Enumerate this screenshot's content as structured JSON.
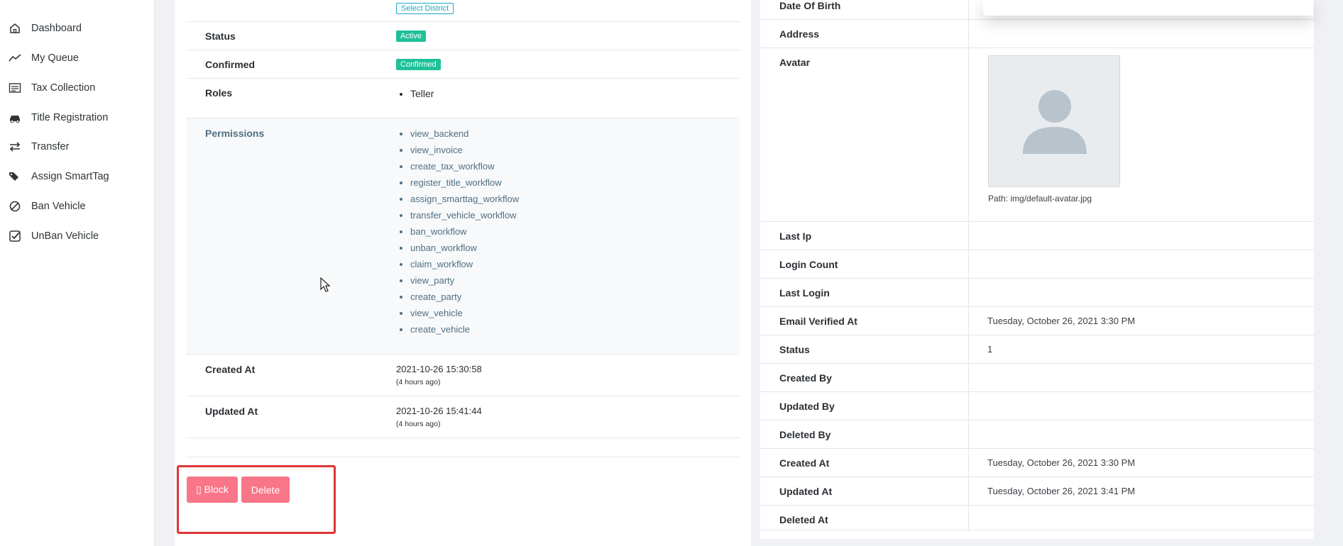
{
  "sidebar": {
    "items": [
      {
        "label": "Dashboard",
        "icon": "home-icon"
      },
      {
        "label": "My Queue",
        "icon": "trend-icon"
      },
      {
        "label": "Tax Collection",
        "icon": "list-icon"
      },
      {
        "label": "Title Registration",
        "icon": "car-icon"
      },
      {
        "label": "Transfer",
        "icon": "swap-icon"
      },
      {
        "label": "Assign SmartTag",
        "icon": "tags-icon"
      },
      {
        "label": "Ban Vehicle",
        "icon": "ban-icon"
      },
      {
        "label": "UnBan Vehicle",
        "icon": "check-square-icon"
      }
    ]
  },
  "user_detail": {
    "district_button": "Select District",
    "status_label": "Status",
    "status_value": "Active",
    "confirmed_label": "Confirmed",
    "confirmed_value": "Confirmed",
    "roles_label": "Roles",
    "roles": [
      "Teller"
    ],
    "permissions_label": "Permissions",
    "permissions": [
      "view_backend",
      "view_invoice",
      "create_tax_workflow",
      "register_title_workflow",
      "assign_smarttag_workflow",
      "transfer_vehicle_workflow",
      "ban_workflow",
      "unban_workflow",
      "claim_workflow",
      "view_party",
      "create_party",
      "view_vehicle",
      "create_vehicle"
    ],
    "created_at_label": "Created At",
    "created_at": "2021-10-26 15:30:58",
    "created_at_relative": "(4 hours ago)",
    "updated_at_label": "Updated At",
    "updated_at": "2021-10-26 15:41:44",
    "updated_at_relative": "(4 hours ago)"
  },
  "actions": {
    "block_label": "▯ Block",
    "delete_label": "Delete"
  },
  "profile": {
    "dob_label": "Date Of Birth",
    "address_label": "Address",
    "avatar_label": "Avatar",
    "avatar_path": "Path: img/default-avatar.jpg",
    "rows": [
      {
        "label": "Last Ip",
        "value": ""
      },
      {
        "label": "Login Count",
        "value": ""
      },
      {
        "label": "Last Login",
        "value": ""
      },
      {
        "label": "Email Verified At",
        "value": "Tuesday, October 26, 2021 3:30 PM"
      },
      {
        "label": "Status",
        "value": "1"
      },
      {
        "label": "Created By",
        "value": ""
      },
      {
        "label": "Updated By",
        "value": ""
      },
      {
        "label": "Deleted By",
        "value": ""
      },
      {
        "label": "Created At",
        "value": "Tuesday, October 26, 2021 3:30 PM"
      },
      {
        "label": "Updated At",
        "value": "Tuesday, October 26, 2021 3:41 PM"
      },
      {
        "label": "Deleted At",
        "value": ""
      }
    ]
  }
}
